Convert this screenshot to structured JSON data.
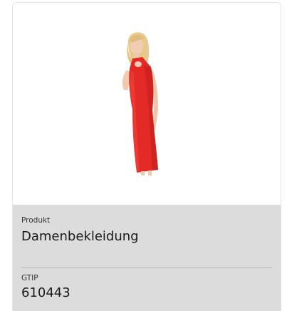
{
  "product_card": {
    "image": {
      "subject": "red sleeveless dress",
      "dress_color": "#e42a26"
    },
    "product_label": "Produkt",
    "product_value": "Damenbekleidung",
    "gtip_label": "GTIP",
    "gtip_value": "610443"
  }
}
